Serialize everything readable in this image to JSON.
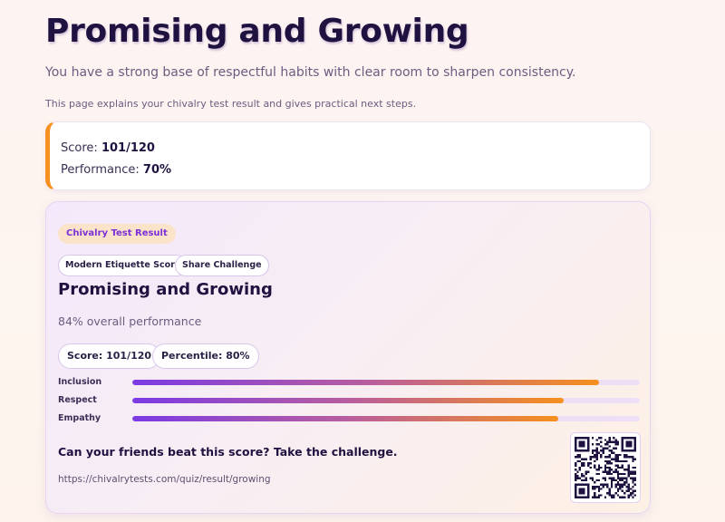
{
  "header": {
    "title": "Promising and Growing",
    "subtitle": "You have a strong base of respectful habits with clear room to sharpen consistency.",
    "explanation": "This page explains your chivalry test result and gives practical next steps."
  },
  "summary": {
    "score_label": "Score: ",
    "score_value": "101/120",
    "performance_label": "Performance: ",
    "performance_value": "70%",
    "accent_color": "#f6901e"
  },
  "result_card": {
    "badge": "Chivalry Test Result",
    "chips": [
      "Modern Etiquette Score",
      "Share Challenge"
    ],
    "title": "Promising and Growing",
    "overall": "84% overall performance",
    "stats": [
      "Score: 101/120",
      "Percentile: 80%"
    ],
    "bars": [
      {
        "label": "Inclusion",
        "value": 0.92
      },
      {
        "label": "Respect",
        "value": 0.85
      },
      {
        "label": "Empathy",
        "value": 0.84
      }
    ],
    "challenge_text": "Can your friends beat this score? Take the challenge.",
    "share_url": "https://chivalrytests.com/quiz/result/growing",
    "qr_icon": "qr-code-icon"
  },
  "colors": {
    "title": "#1f1240",
    "accent_orange": "#f6901e",
    "accent_purple": "#7b3ae4"
  }
}
